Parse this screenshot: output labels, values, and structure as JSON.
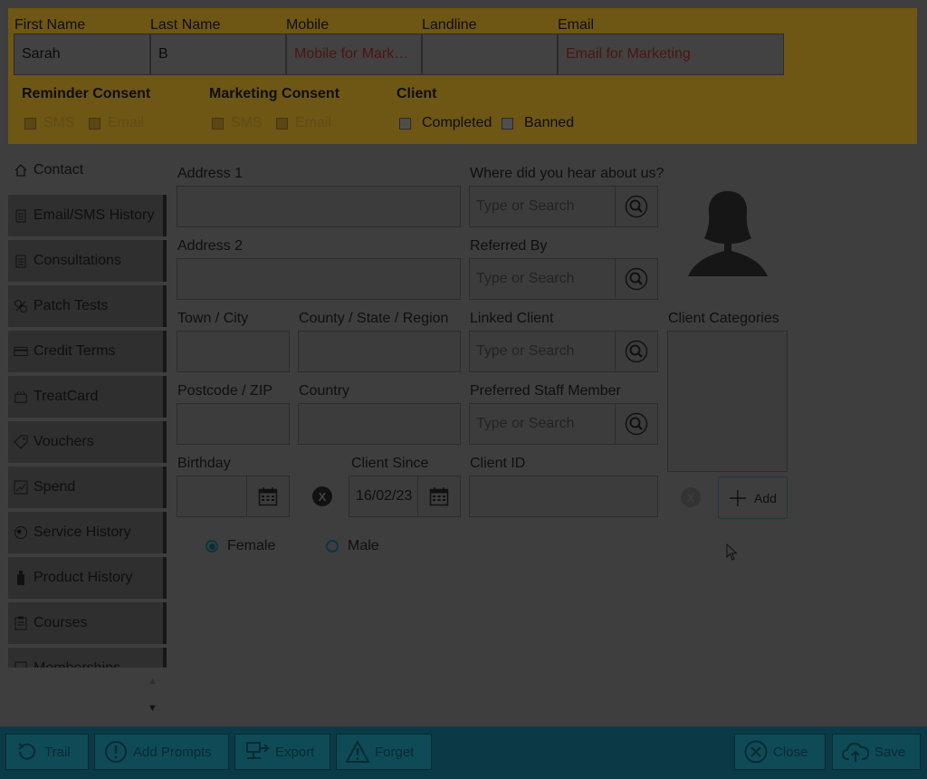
{
  "top": {
    "first_name_label": "First Name",
    "last_name_label": "Last Name",
    "mobile_label": "Mobile",
    "landline_label": "Landline",
    "email_label": "Email",
    "first_name_value": "Sarah",
    "last_name_value": "B",
    "mobile_placeholder": "Mobile for Market...",
    "landline_value": "",
    "email_placeholder": "Email for Marketing",
    "reminder_title": "Reminder Consent",
    "marketing_title": "Marketing Consent",
    "client_title": "Client",
    "sms": "SMS",
    "email": "Email",
    "completed": "Completed",
    "banned": "Banned"
  },
  "nav": {
    "items": [
      {
        "label": "Contact",
        "icon": "home-icon"
      },
      {
        "label": "Email/SMS History",
        "icon": "document-icon"
      },
      {
        "label": "Consultations",
        "icon": "document-icon"
      },
      {
        "label": "Patch Tests",
        "icon": "patch-icon"
      },
      {
        "label": "Credit Terms",
        "icon": "credit-card-icon"
      },
      {
        "label": "TreatCard",
        "icon": "treatcard-icon"
      },
      {
        "label": "Vouchers",
        "icon": "tag-icon"
      },
      {
        "label": "Spend",
        "icon": "chart-icon"
      },
      {
        "label": "Service History",
        "icon": "globe-icon"
      },
      {
        "label": "Product History",
        "icon": "bottle-icon"
      },
      {
        "label": "Courses",
        "icon": "clipboard-icon"
      },
      {
        "label": "Memberships",
        "icon": "card-icon"
      }
    ]
  },
  "form": {
    "address1_label": "Address 1",
    "address2_label": "Address 2",
    "town_label": "Town / City",
    "county_label": "County / State / Region",
    "postcode_label": "Postcode / ZIP",
    "country_label": "Country",
    "birthday_label": "Birthday",
    "client_since_label": "Client Since",
    "client_since_value": "16/02/23",
    "hear_label": "Where did you hear about us?",
    "referred_label": "Referred By",
    "linked_label": "Linked Client",
    "staff_label": "Preferred Staff Member",
    "client_id_label": "Client ID",
    "search_placeholder": "Type or Search",
    "categories_label": "Client Categories",
    "add_label": "Add",
    "clear_glyph": "X",
    "female_label": "Female",
    "male_label": "Male",
    "gender_selected": "Female"
  },
  "toolbar": {
    "trail": "Trail",
    "add_prompts": "Add Prompts",
    "export": "Export",
    "forget": "Forget",
    "close": "Close",
    "save": "Save"
  },
  "colors": {
    "top_band": "#6e5614",
    "bottom_bar": "#0c3a44",
    "button": "#0f4b57",
    "placeholder_red": "#4a1612"
  }
}
